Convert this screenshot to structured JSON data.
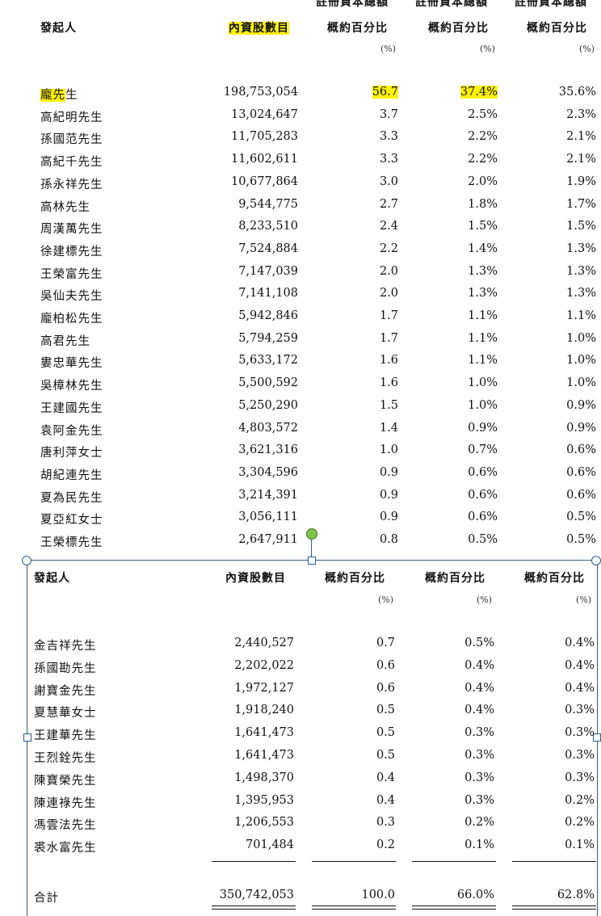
{
  "top_headers": {
    "promoter": "發起人",
    "shares": "內資股數目",
    "col3_line1": "註冊資本總額",
    "col3_line2": "概約百分比",
    "col4_line1": "註冊資本總額",
    "col4_line2": "概約百分比",
    "col5_line1": "註冊資本總額",
    "col5_line2": "概約百分比",
    "unit": "(%)"
  },
  "top_rows": [
    {
      "name": "龐先生",
      "shares": "198,753,054",
      "p1": "56.7",
      "p2": "37.4%",
      "p3": "35.6%"
    },
    {
      "name": "高紀明先生",
      "shares": "13,024,647",
      "p1": "3.7",
      "p2": "2.5%",
      "p3": "2.3%"
    },
    {
      "name": "孫國范先生",
      "shares": "11,705,283",
      "p1": "3.3",
      "p2": "2.2%",
      "p3": "2.1%"
    },
    {
      "name": "高紀千先生",
      "shares": "11,602,611",
      "p1": "3.3",
      "p2": "2.2%",
      "p3": "2.1%"
    },
    {
      "name": "孫永祥先生",
      "shares": "10,677,864",
      "p1": "3.0",
      "p2": "2.0%",
      "p3": "1.9%"
    },
    {
      "name": "高林先生",
      "shares": "9,544,775",
      "p1": "2.7",
      "p2": "1.8%",
      "p3": "1.7%"
    },
    {
      "name": "周漢萬先生",
      "shares": "8,233,510",
      "p1": "2.4",
      "p2": "1.5%",
      "p3": "1.5%"
    },
    {
      "name": "徐建標先生",
      "shares": "7,524,884",
      "p1": "2.2",
      "p2": "1.4%",
      "p3": "1.3%"
    },
    {
      "name": "王榮富先生",
      "shares": "7,147,039",
      "p1": "2.0",
      "p2": "1.3%",
      "p3": "1.3%"
    },
    {
      "name": "吳仙夫先生",
      "shares": "7,141,108",
      "p1": "2.0",
      "p2": "1.3%",
      "p3": "1.3%"
    },
    {
      "name": "龐柏松先生",
      "shares": "5,942,846",
      "p1": "1.7",
      "p2": "1.1%",
      "p3": "1.1%"
    },
    {
      "name": "高君先生",
      "shares": "5,794,259",
      "p1": "1.7",
      "p2": "1.1%",
      "p3": "1.0%"
    },
    {
      "name": "婁忠華先生",
      "shares": "5,633,172",
      "p1": "1.6",
      "p2": "1.1%",
      "p3": "1.0%"
    },
    {
      "name": "吳樟林先生",
      "shares": "5,500,592",
      "p1": "1.6",
      "p2": "1.0%",
      "p3": "1.0%"
    },
    {
      "name": "王建國先生",
      "shares": "5,250,290",
      "p1": "1.5",
      "p2": "1.0%",
      "p3": "0.9%"
    },
    {
      "name": "袁阿金先生",
      "shares": "4,803,572",
      "p1": "1.4",
      "p2": "0.9%",
      "p3": "0.9%"
    },
    {
      "name": "唐利萍女士",
      "shares": "3,621,316",
      "p1": "1.0",
      "p2": "0.7%",
      "p3": "0.6%"
    },
    {
      "name": "胡紀連先生",
      "shares": "3,304,596",
      "p1": "0.9",
      "p2": "0.6%",
      "p3": "0.6%"
    },
    {
      "name": "夏為民先生",
      "shares": "3,214,391",
      "p1": "0.9",
      "p2": "0.6%",
      "p3": "0.6%"
    },
    {
      "name": "夏亞紅女士",
      "shares": "3,056,111",
      "p1": "0.9",
      "p2": "0.6%",
      "p3": "0.5%"
    },
    {
      "name": "王榮標先生",
      "shares": "2,647,911",
      "p1": "0.8",
      "p2": "0.5%",
      "p3": "0.5%"
    }
  ],
  "bottom_headers": {
    "promoter": "發起人",
    "shares": "內資股數目",
    "col3": "概約百分比",
    "col4": "概約百分比",
    "col5": "概約百分比",
    "unit": "(%)"
  },
  "bottom_rows": [
    {
      "name": "金吉祥先生",
      "shares": "2,440,527",
      "p1": "0.7",
      "p2": "0.5%",
      "p3": "0.4%"
    },
    {
      "name": "孫國勘先生",
      "shares": "2,202,022",
      "p1": "0.6",
      "p2": "0.4%",
      "p3": "0.4%"
    },
    {
      "name": "謝寶金先生",
      "shares": "1,972,127",
      "p1": "0.6",
      "p2": "0.4%",
      "p3": "0.4%"
    },
    {
      "name": "夏慧華女士",
      "shares": "1,918,240",
      "p1": "0.5",
      "p2": "0.4%",
      "p3": "0.3%"
    },
    {
      "name": "王建華先生",
      "shares": "1,641,473",
      "p1": "0.5",
      "p2": "0.3%",
      "p3": "0.3%"
    },
    {
      "name": "王烈銓先生",
      "shares": "1,641,473",
      "p1": "0.5",
      "p2": "0.3%",
      "p3": "0.3%"
    },
    {
      "name": "陳寶榮先生",
      "shares": "1,498,370",
      "p1": "0.4",
      "p2": "0.3%",
      "p3": "0.3%"
    },
    {
      "name": "陳連祿先生",
      "shares": "1,395,953",
      "p1": "0.4",
      "p2": "0.3%",
      "p3": "0.2%"
    },
    {
      "name": "馮雲法先生",
      "shares": "1,206,553",
      "p1": "0.3",
      "p2": "0.2%",
      "p3": "0.2%"
    },
    {
      "name": "裘水富先生",
      "shares": "701,484",
      "p1": "0.2",
      "p2": "0.1%",
      "p3": "0.1%"
    }
  ],
  "total": {
    "label": "合計",
    "shares": "350,742,053",
    "p1": "100.0",
    "p2": "66.0%",
    "p3": "62.8%"
  },
  "highlight_color": "#fff200",
  "selection_color": "#2f5d8a"
}
